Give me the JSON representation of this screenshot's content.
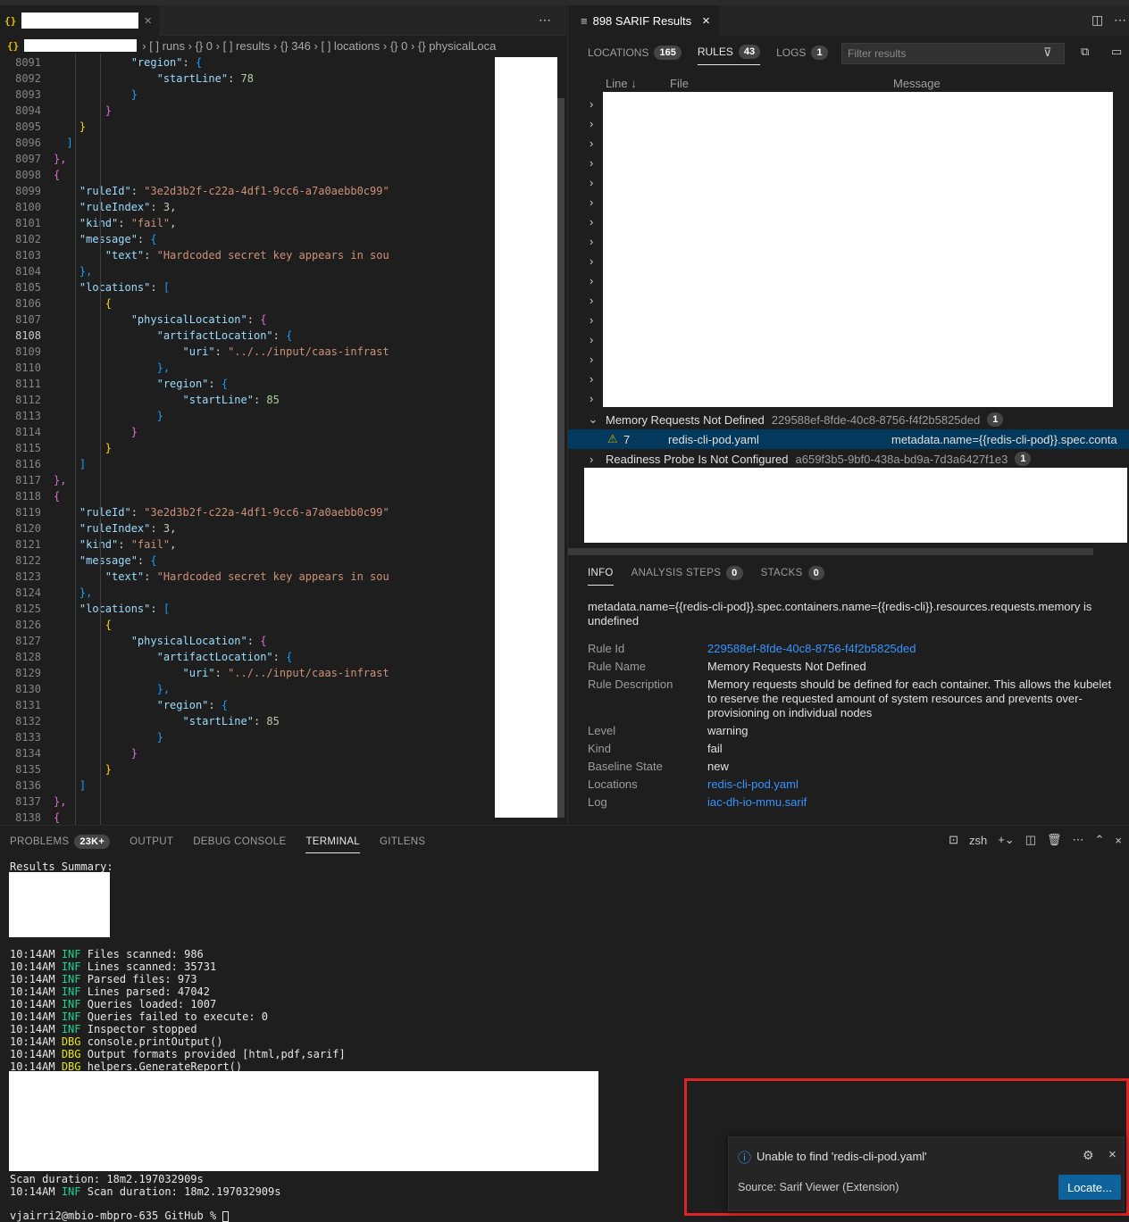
{
  "editor": {
    "tab_close": "×",
    "tab_more": "⋯",
    "breadcrumbs": [
      "[ ] runs",
      "{} 0",
      "[ ] results",
      "{} 346",
      "[ ] locations",
      "{} 0",
      "{} physicalLoca"
    ],
    "lines": [
      {
        "n": "8091",
        "tokens": [
          [
            "k",
            "            \"region\""
          ],
          [
            "p",
            ": "
          ],
          [
            "b3",
            "{"
          ]
        ]
      },
      {
        "n": "8092",
        "tokens": [
          [
            "k",
            "                \"startLine\""
          ],
          [
            "p",
            ": "
          ],
          [
            "n",
            "78"
          ]
        ]
      },
      {
        "n": "8093",
        "tokens": [
          [
            "b3",
            "            }"
          ]
        ]
      },
      {
        "n": "8094",
        "tokens": [
          [
            "b2",
            "        }"
          ]
        ]
      },
      {
        "n": "8095",
        "tokens": [
          [
            "b1",
            "    }"
          ]
        ]
      },
      {
        "n": "8096",
        "tokens": [
          [
            "b3",
            "  ]"
          ]
        ]
      },
      {
        "n": "8097",
        "tokens": [
          [
            "b2",
            "},"
          ]
        ]
      },
      {
        "n": "8098",
        "tokens": [
          [
            "b2",
            "{"
          ]
        ]
      },
      {
        "n": "8099",
        "tokens": [
          [
            "k",
            "    \"ruleId\""
          ],
          [
            "p",
            ": "
          ],
          [
            "s",
            "\"3e2d3b2f-c22a-4df1-9cc6-a7a0aebb0c99\""
          ]
        ]
      },
      {
        "n": "8100",
        "tokens": [
          [
            "k",
            "    \"ruleIndex\""
          ],
          [
            "p",
            ": "
          ],
          [
            "n",
            "3"
          ],
          [
            "p",
            ","
          ]
        ]
      },
      {
        "n": "8101",
        "tokens": [
          [
            "k",
            "    \"kind\""
          ],
          [
            "p",
            ": "
          ],
          [
            "s",
            "\"fail\""
          ],
          [
            "p",
            ","
          ]
        ]
      },
      {
        "n": "8102",
        "tokens": [
          [
            "k",
            "    \"message\""
          ],
          [
            "p",
            ": "
          ],
          [
            "b3",
            "{"
          ]
        ]
      },
      {
        "n": "8103",
        "tokens": [
          [
            "k",
            "        \"text\""
          ],
          [
            "p",
            ": "
          ],
          [
            "s",
            "\"Hardcoded secret key appears in sou"
          ]
        ]
      },
      {
        "n": "8104",
        "tokens": [
          [
            "b3",
            "    },"
          ]
        ]
      },
      {
        "n": "8105",
        "tokens": [
          [
            "k",
            "    \"locations\""
          ],
          [
            "p",
            ": "
          ],
          [
            "b3",
            "["
          ]
        ]
      },
      {
        "n": "8106",
        "tokens": [
          [
            "b1",
            "        {"
          ]
        ]
      },
      {
        "n": "8107",
        "tokens": [
          [
            "k",
            "            \"physicalLocation\""
          ],
          [
            "p",
            ": "
          ],
          [
            "b2",
            "{"
          ]
        ]
      },
      {
        "n": "8108",
        "tokens": [
          [
            "k",
            "                \"artifactLocation\""
          ],
          [
            "p",
            ": "
          ],
          [
            "b3",
            "{"
          ]
        ]
      },
      {
        "n": "8109",
        "tokens": [
          [
            "k",
            "                    \"uri\""
          ],
          [
            "p",
            ": "
          ],
          [
            "s",
            "\"../../input/caas-infrast"
          ]
        ]
      },
      {
        "n": "8110",
        "tokens": [
          [
            "b3",
            "                },"
          ]
        ]
      },
      {
        "n": "8111",
        "tokens": [
          [
            "k",
            "                \"region\""
          ],
          [
            "p",
            ": "
          ],
          [
            "b3",
            "{"
          ]
        ]
      },
      {
        "n": "8112",
        "tokens": [
          [
            "k",
            "                    \"startLine\""
          ],
          [
            "p",
            ": "
          ],
          [
            "n",
            "85"
          ]
        ]
      },
      {
        "n": "8113",
        "tokens": [
          [
            "b3",
            "                }"
          ]
        ]
      },
      {
        "n": "8114",
        "tokens": [
          [
            "b2",
            "            }"
          ]
        ]
      },
      {
        "n": "8115",
        "tokens": [
          [
            "b1",
            "        }"
          ]
        ]
      },
      {
        "n": "8116",
        "tokens": [
          [
            "b3",
            "    ]"
          ]
        ]
      },
      {
        "n": "8117",
        "tokens": [
          [
            "b2",
            "},"
          ]
        ]
      },
      {
        "n": "8118",
        "tokens": [
          [
            "b2",
            "{"
          ]
        ]
      },
      {
        "n": "8119",
        "tokens": [
          [
            "k",
            "    \"ruleId\""
          ],
          [
            "p",
            ": "
          ],
          [
            "s",
            "\"3e2d3b2f-c22a-4df1-9cc6-a7a0aebb0c99\""
          ]
        ]
      },
      {
        "n": "8120",
        "tokens": [
          [
            "k",
            "    \"ruleIndex\""
          ],
          [
            "p",
            ": "
          ],
          [
            "n",
            "3"
          ],
          [
            "p",
            ","
          ]
        ]
      },
      {
        "n": "8121",
        "tokens": [
          [
            "k",
            "    \"kind\""
          ],
          [
            "p",
            ": "
          ],
          [
            "s",
            "\"fail\""
          ],
          [
            "p",
            ","
          ]
        ]
      },
      {
        "n": "8122",
        "tokens": [
          [
            "k",
            "    \"message\""
          ],
          [
            "p",
            ": "
          ],
          [
            "b3",
            "{"
          ]
        ]
      },
      {
        "n": "8123",
        "tokens": [
          [
            "k",
            "        \"text\""
          ],
          [
            "p",
            ": "
          ],
          [
            "s",
            "\"Hardcoded secret key appears in sou"
          ]
        ]
      },
      {
        "n": "8124",
        "tokens": [
          [
            "b3",
            "    },"
          ]
        ]
      },
      {
        "n": "8125",
        "tokens": [
          [
            "k",
            "    \"locations\""
          ],
          [
            "p",
            ": "
          ],
          [
            "b3",
            "["
          ]
        ]
      },
      {
        "n": "8126",
        "tokens": [
          [
            "b1",
            "        {"
          ]
        ]
      },
      {
        "n": "8127",
        "tokens": [
          [
            "k",
            "            \"physicalLocation\""
          ],
          [
            "p",
            ": "
          ],
          [
            "b2",
            "{"
          ]
        ]
      },
      {
        "n": "8128",
        "tokens": [
          [
            "k",
            "                \"artifactLocation\""
          ],
          [
            "p",
            ": "
          ],
          [
            "b3",
            "{"
          ]
        ]
      },
      {
        "n": "8129",
        "tokens": [
          [
            "k",
            "                    \"uri\""
          ],
          [
            "p",
            ": "
          ],
          [
            "s",
            "\"../../input/caas-infrast"
          ]
        ]
      },
      {
        "n": "8130",
        "tokens": [
          [
            "b3",
            "                },"
          ]
        ]
      },
      {
        "n": "8131",
        "tokens": [
          [
            "k",
            "                \"region\""
          ],
          [
            "p",
            ": "
          ],
          [
            "b3",
            "{"
          ]
        ]
      },
      {
        "n": "8132",
        "tokens": [
          [
            "k",
            "                    \"startLine\""
          ],
          [
            "p",
            ": "
          ],
          [
            "n",
            "85"
          ]
        ]
      },
      {
        "n": "8133",
        "tokens": [
          [
            "b3",
            "                }"
          ]
        ]
      },
      {
        "n": "8134",
        "tokens": [
          [
            "b2",
            "            }"
          ]
        ]
      },
      {
        "n": "8135",
        "tokens": [
          [
            "b1",
            "        }"
          ]
        ]
      },
      {
        "n": "8136",
        "tokens": [
          [
            "b3",
            "    ]"
          ]
        ]
      },
      {
        "n": "8137",
        "tokens": [
          [
            "b2",
            "},"
          ]
        ]
      },
      {
        "n": "8138",
        "tokens": [
          [
            "b2",
            "{"
          ]
        ]
      }
    ],
    "current_line": "8108"
  },
  "sarif": {
    "title": "898 SARIF Results",
    "tabs": [
      {
        "label": "LOCATIONS",
        "count": "165"
      },
      {
        "label": "RULES",
        "count": "43"
      },
      {
        "label": "LOGS",
        "count": "1"
      }
    ],
    "filter_placeholder": "Filter results",
    "columns": {
      "line": "Line ↓",
      "file": "File",
      "message": "Message"
    },
    "expanded_rule": {
      "title": "Memory Requests Not Defined",
      "id": "229588ef-8fde-40c8-8756-f4f2b5825ded",
      "count": "1"
    },
    "selected_result": {
      "line": "7",
      "file": "redis-cli-pod.yaml",
      "message": "metadata.name={{redis-cli-pod}}.spec.conta"
    },
    "next_rule": {
      "title": "Readiness Probe Is Not Configured",
      "id": "a659f3b5-9bf0-438a-bd9a-7d3a6427f1e3",
      "count": "1"
    },
    "info_tabs": [
      {
        "label": "INFO",
        "count": ""
      },
      {
        "label": "ANALYSIS STEPS",
        "count": "0"
      },
      {
        "label": "STACKS",
        "count": "0"
      }
    ],
    "info": {
      "message": "metadata.name={{redis-cli-pod}}.spec.containers.name={{redis-cli}}.resources.requests.memory is undefined",
      "rule_id_label": "Rule Id",
      "rule_id": "229588ef-8fde-40c8-8756-f4f2b5825ded",
      "rule_name_label": "Rule Name",
      "rule_name": "Memory Requests Not Defined",
      "rule_desc_label": "Rule Description",
      "rule_desc": "Memory requests should be defined for each container. This allows the kubelet to reserve the requested amount of system resources and prevents over-provisioning on individual nodes",
      "level_label": "Level",
      "level": "warning",
      "kind_label": "Kind",
      "kind": "fail",
      "baseline_label": "Baseline State",
      "baseline": "new",
      "locations_label": "Locations",
      "locations": "redis-cli-pod.yaml",
      "log_label": "Log",
      "log": "iac-dh-io-mmu.sarif"
    }
  },
  "panel": {
    "tabs": [
      {
        "label": "PROBLEMS",
        "count": "23K+"
      },
      {
        "label": "OUTPUT",
        "count": ""
      },
      {
        "label": "DEBUG CONSOLE",
        "count": ""
      },
      {
        "label": "TERMINAL",
        "count": ""
      },
      {
        "label": "GITLENS",
        "count": ""
      }
    ],
    "shell": "zsh",
    "terminal_header": "Results Summary:",
    "log_lines": [
      {
        "time": "10:14AM",
        "lvl": "INF",
        "text": "Files scanned: 986"
      },
      {
        "time": "10:14AM",
        "lvl": "INF",
        "text": "Lines scanned: 35731"
      },
      {
        "time": "10:14AM",
        "lvl": "INF",
        "text": "Parsed files: 973"
      },
      {
        "time": "10:14AM",
        "lvl": "INF",
        "text": "Lines parsed: 47042"
      },
      {
        "time": "10:14AM",
        "lvl": "INF",
        "text": "Queries loaded: 1007"
      },
      {
        "time": "10:14AM",
        "lvl": "INF",
        "text": "Queries failed to execute: 0"
      },
      {
        "time": "10:14AM",
        "lvl": "INF",
        "text": "Inspector stopped"
      },
      {
        "time": "10:14AM",
        "lvl": "DBG",
        "text": "console.printOutput()"
      },
      {
        "time": "10:14AM",
        "lvl": "DBG",
        "text": "Output formats provided [html,pdf,sarif]"
      },
      {
        "time": "10:14AM",
        "lvl": "DBG",
        "text": "helpers.GenerateReport()"
      }
    ],
    "scan_duration": "Scan duration: 18m2.197032909s",
    "final_line": {
      "time": "10:14AM",
      "lvl": "INF",
      "text": "Scan duration: 18m2.197032909s"
    },
    "prompt": "vjairri2@mbio-mbpro-635 GitHub % "
  },
  "notification": {
    "message": "Unable to find 'redis-cli-pod.yaml'",
    "source": "Source: Sarif Viewer (Extension)",
    "button": "Locate..."
  }
}
